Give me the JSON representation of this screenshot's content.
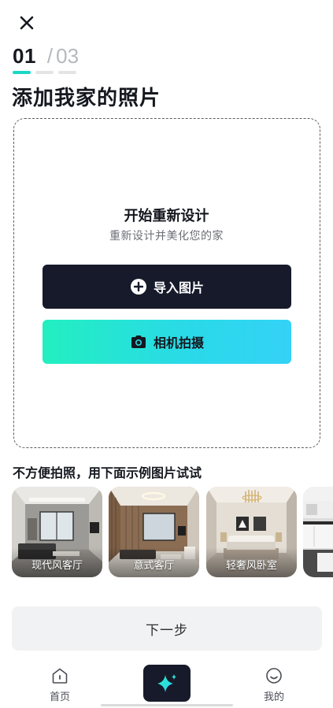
{
  "header": {
    "step_current": "01",
    "step_separator": "/",
    "step_total": "03",
    "progress": {
      "current_step": 1,
      "total_steps": 3
    },
    "title": "添加我家的照片"
  },
  "upload": {
    "heading": "开始重新设计",
    "subtitle": "重新设计并美化您的家",
    "import_label": "导入图片",
    "camera_label": "相机拍摄",
    "import_icon": "plus-circle-icon",
    "camera_icon": "camera-icon"
  },
  "samples": {
    "title": "不方便拍照，用下面示例图片试试",
    "items": [
      {
        "label": "现代风客厅"
      },
      {
        "label": "意式客厅"
      },
      {
        "label": "轻奢风卧室"
      },
      {
        "label": ""
      }
    ]
  },
  "next_button": {
    "label": "下一步"
  },
  "tabbar": {
    "items": [
      {
        "label": "首页",
        "icon": "home-icon"
      },
      {
        "label": "",
        "icon": "sparkle-icon"
      },
      {
        "label": "我的",
        "icon": "smile-face-icon"
      }
    ]
  },
  "colors": {
    "accent": "#18d8c5",
    "dark": "#171a2a",
    "gradient_start": "#22efc0",
    "gradient_end": "#34d2f6"
  }
}
